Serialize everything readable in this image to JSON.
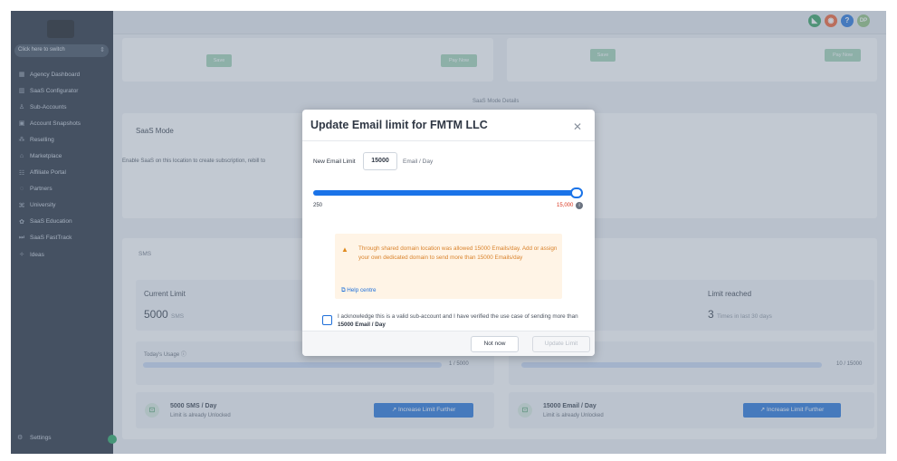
{
  "sidebar": {
    "switcher_label": "Click here to switch",
    "items": [
      {
        "icon": "grid-icon",
        "glyph": "▦",
        "label": "Agency Dashboard"
      },
      {
        "icon": "chart-icon",
        "glyph": "▥",
        "label": "SaaS Configurator"
      },
      {
        "icon": "user-icon",
        "glyph": "♙",
        "label": "Sub-Accounts"
      },
      {
        "icon": "snapshot-icon",
        "glyph": "▣",
        "label": "Account Snapshots"
      },
      {
        "icon": "reselling-icon",
        "glyph": "⁂",
        "label": "Reselling"
      },
      {
        "icon": "marketplace-icon",
        "glyph": "⌂",
        "label": "Marketplace"
      },
      {
        "icon": "affiliate-icon",
        "glyph": "☷",
        "label": "Affiliate Portal"
      },
      {
        "icon": "partners-icon",
        "glyph": "◌",
        "label": "Partners"
      },
      {
        "icon": "university-icon",
        "glyph": "⌘",
        "label": "University"
      },
      {
        "icon": "education-icon",
        "glyph": "✿",
        "label": "SaaS Education"
      },
      {
        "icon": "fasttrack-icon",
        "glyph": "⏭",
        "label": "SaaS FastTrack"
      },
      {
        "icon": "ideas-icon",
        "glyph": "✧",
        "label": "Ideas"
      }
    ],
    "settings_label": "Settings"
  },
  "header": {
    "icons": [
      {
        "name": "megaphone-icon",
        "glyph": "📢",
        "color": "#2e9d5a"
      },
      {
        "name": "bell-icon",
        "glyph": "🔔",
        "color": "#f05a28"
      },
      {
        "name": "help-icon",
        "glyph": "?",
        "color": "#1e6fd9"
      },
      {
        "name": "avatar",
        "glyph": "DP",
        "color": "#8fbf7a"
      }
    ]
  },
  "background": {
    "top_buttons": [
      "Save",
      "Pay Now",
      "Save",
      "Pay Now"
    ],
    "saas_mode_details": "SaaS Mode Details",
    "saas_mode_title": "SaaS Mode",
    "saas_mode_desc": "Enable SaaS on this location to create subscription, rebill to",
    "sms_title": "SMS",
    "current_limit_label": "Current Limit",
    "current_limit_value": "5000",
    "current_limit_unit": "SMS",
    "limit_reached_label": "Limit reached",
    "limit_reached_value": "3",
    "limit_reached_unit": "Times in last 30 days",
    "todays_usage_label": "Today's Usage",
    "sms_usage": "1 / 5000",
    "email_usage": "10 / 15000",
    "sms_rate": "5000 SMS / Day",
    "sms_unlocked": "Limit is already Unlocked",
    "email_rate": "15000 Email / Day",
    "email_unlocked": "Limit is already Unlocked",
    "increase_btn": "Increase Limit Further"
  },
  "modal": {
    "title": "Update Email limit for FMTM LLC",
    "new_limit_label": "New Email Limit",
    "new_limit_value": "15000",
    "unit_label": "Email / Day",
    "slider_min": "250",
    "slider_max": "15,000",
    "slider_fraction": 1.0,
    "warning_text": "Through shared domain location was allowed 15000 Emails/day. Add or assign your own dedicated domain to send more than 15000 Emails/day",
    "help_link": "Help centre",
    "ack_text": "I acknowledge this is a valid sub-account and I have verified the use case of sending more than",
    "ack_bold": "15000 Email / Day",
    "not_now": "Not now",
    "update": "Update Limit"
  }
}
